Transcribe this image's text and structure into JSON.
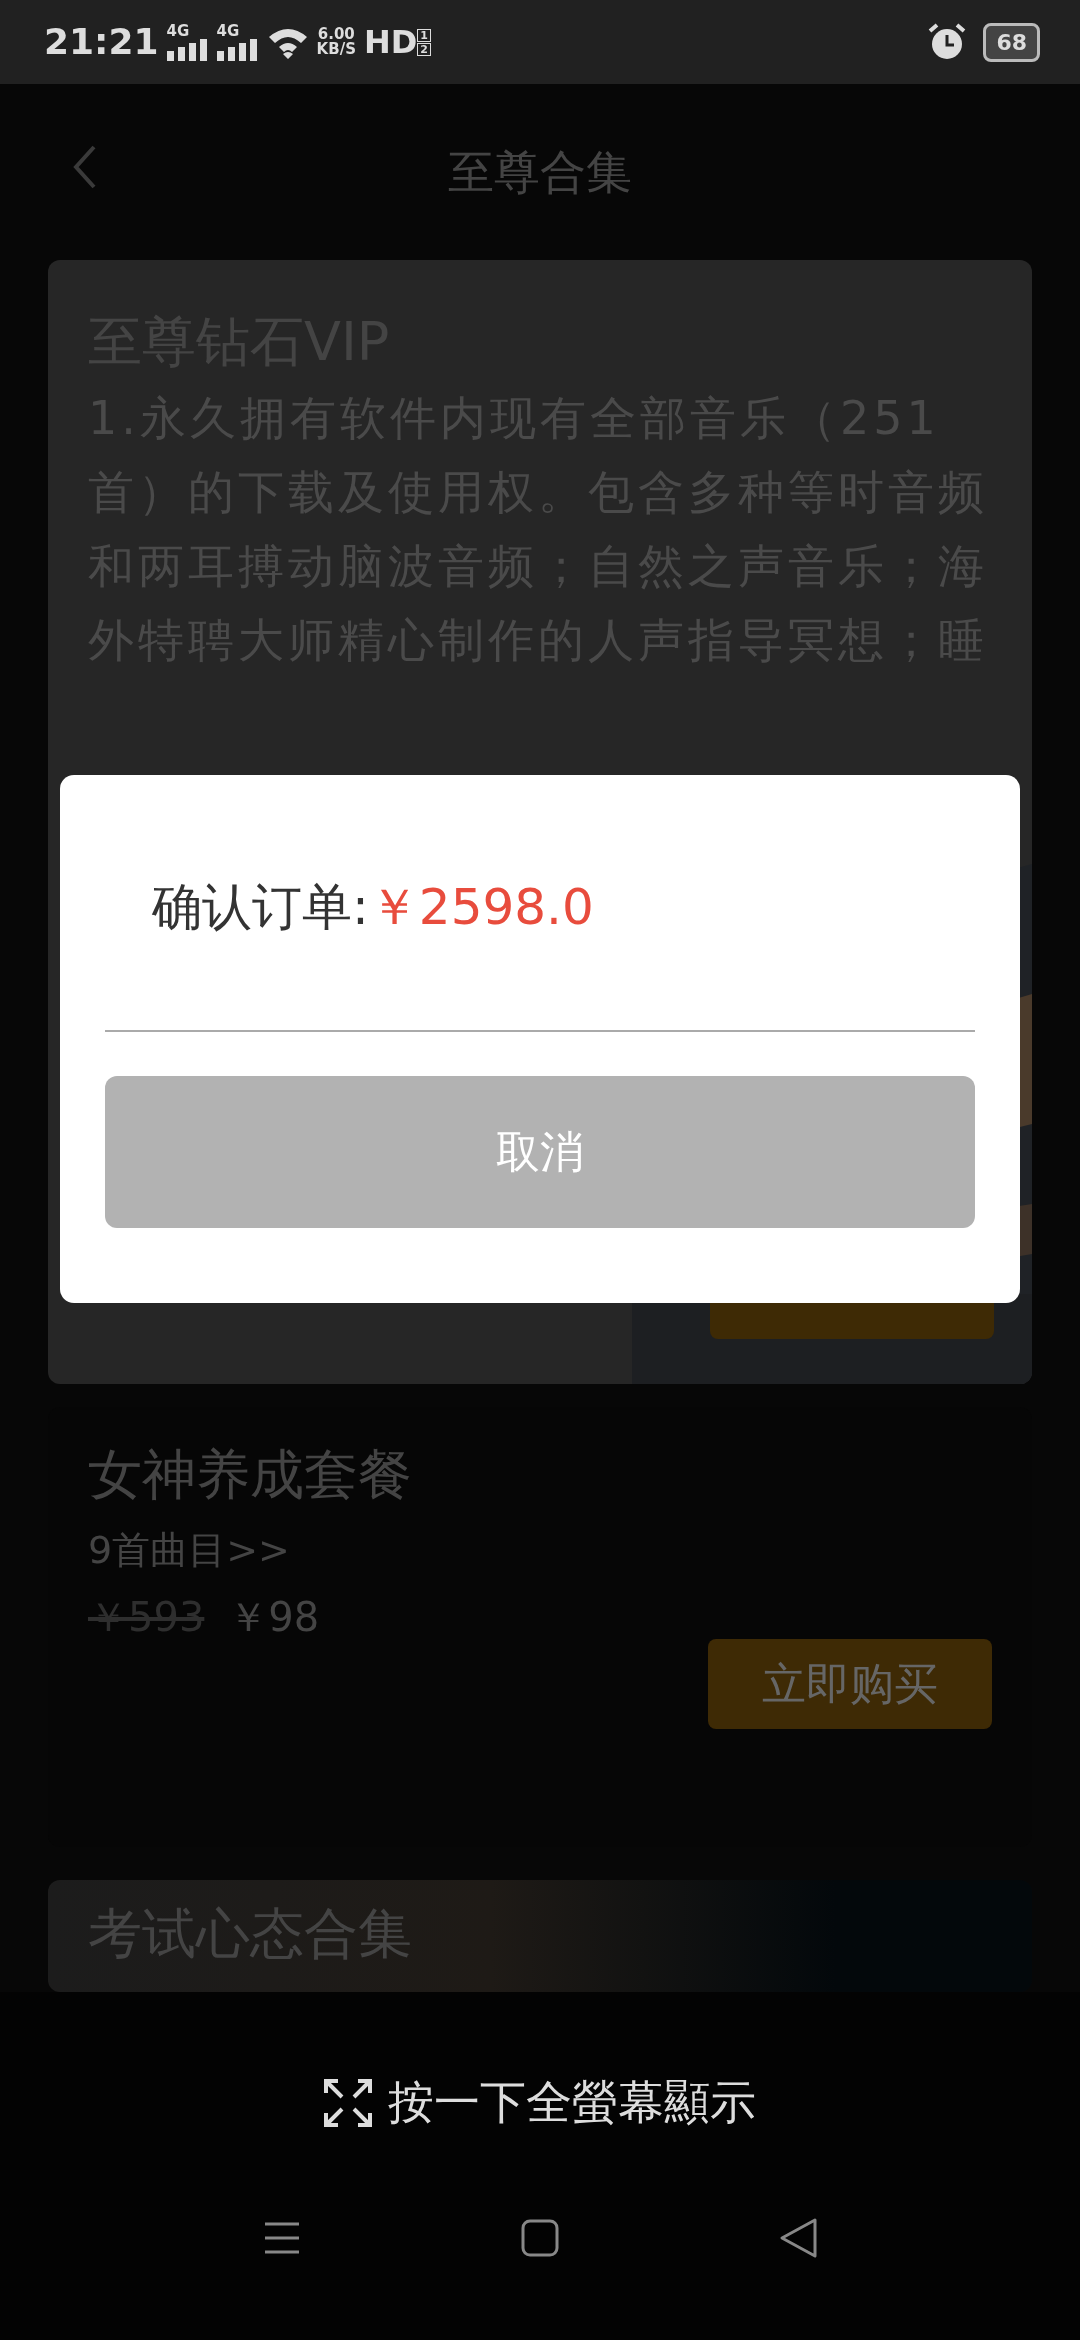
{
  "status_bar": {
    "time": "21:21",
    "network_1": "4G",
    "network_2": "4G",
    "speed_value": "6.00",
    "speed_unit": "KB/S",
    "hd": "HD",
    "sim_1": "1",
    "sim_2": "2",
    "battery": "68"
  },
  "header": {
    "title": "至尊合集"
  },
  "packages": [
    {
      "kind": "featured",
      "title": "至尊钻石VIP",
      "description": "1.永久拥有软件内现有全部音乐（251首）的下载及使用权。包含多种等时音频和两耳搏动脑波音频；自然之声音乐；海外特聘大师精心制作的人声指导冥想；睡"
    },
    {
      "kind": "standard",
      "title": "女神养成套餐",
      "tracks": "9首曲目>>",
      "original_price": "￥593",
      "price": "￥98",
      "button": "立即购买"
    },
    {
      "kind": "partial",
      "title": "考试心态合集"
    }
  ],
  "dialog": {
    "label": "确认订单:",
    "amount": "￥2598.0",
    "cancel": "取消"
  },
  "fullscreen_hint": "按一下全螢幕顯示"
}
